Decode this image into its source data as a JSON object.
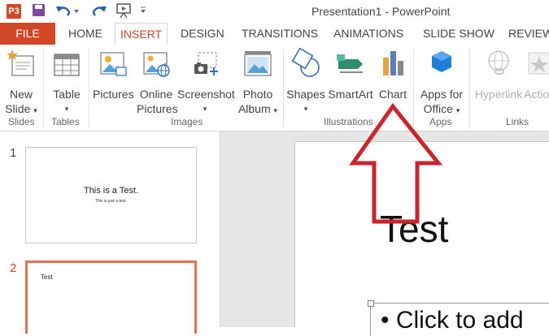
{
  "window": {
    "title": "Presentation1 - PowerPoint",
    "app_badge": "P3"
  },
  "tabs": [
    {
      "label": "FILE"
    },
    {
      "label": "HOME"
    },
    {
      "label": "INSERT"
    },
    {
      "label": "DESIGN"
    },
    {
      "label": "TRANSITIONS"
    },
    {
      "label": "ANIMATIONS"
    },
    {
      "label": "SLIDE SHOW"
    },
    {
      "label": "REVIEW"
    }
  ],
  "ribbon": {
    "new_slide": {
      "line1": "New",
      "line2": "Slide"
    },
    "table": {
      "label": "Table"
    },
    "pictures": {
      "label": "Pictures"
    },
    "online_pictures": {
      "line1": "Online",
      "line2": "Pictures"
    },
    "screenshot": {
      "label": "Screenshot"
    },
    "photo_album": {
      "line1": "Photo",
      "line2": "Album"
    },
    "shapes": {
      "label": "Shapes"
    },
    "smartart": {
      "label": "SmartArt"
    },
    "chart": {
      "label": "Chart"
    },
    "apps_for_office": {
      "line1": "Apps for",
      "line2": "Office"
    },
    "hyperlink": {
      "label": "Hyperlink"
    },
    "action": {
      "label": "Actio"
    },
    "groups": {
      "slides": "Slides",
      "tables": "Tables",
      "images": "Images",
      "illustrations": "Illustrations",
      "apps": "Apps",
      "links": "Links"
    }
  },
  "thumbnails": [
    {
      "number": "1",
      "title": "This is a Test.",
      "subtitle": "This is just a test."
    },
    {
      "number": "2",
      "title": "Test"
    }
  ],
  "slide": {
    "title": "Test",
    "bullet": "Click to add"
  },
  "colors": {
    "accent": "#d24726",
    "arrow": "#c9252c"
  }
}
